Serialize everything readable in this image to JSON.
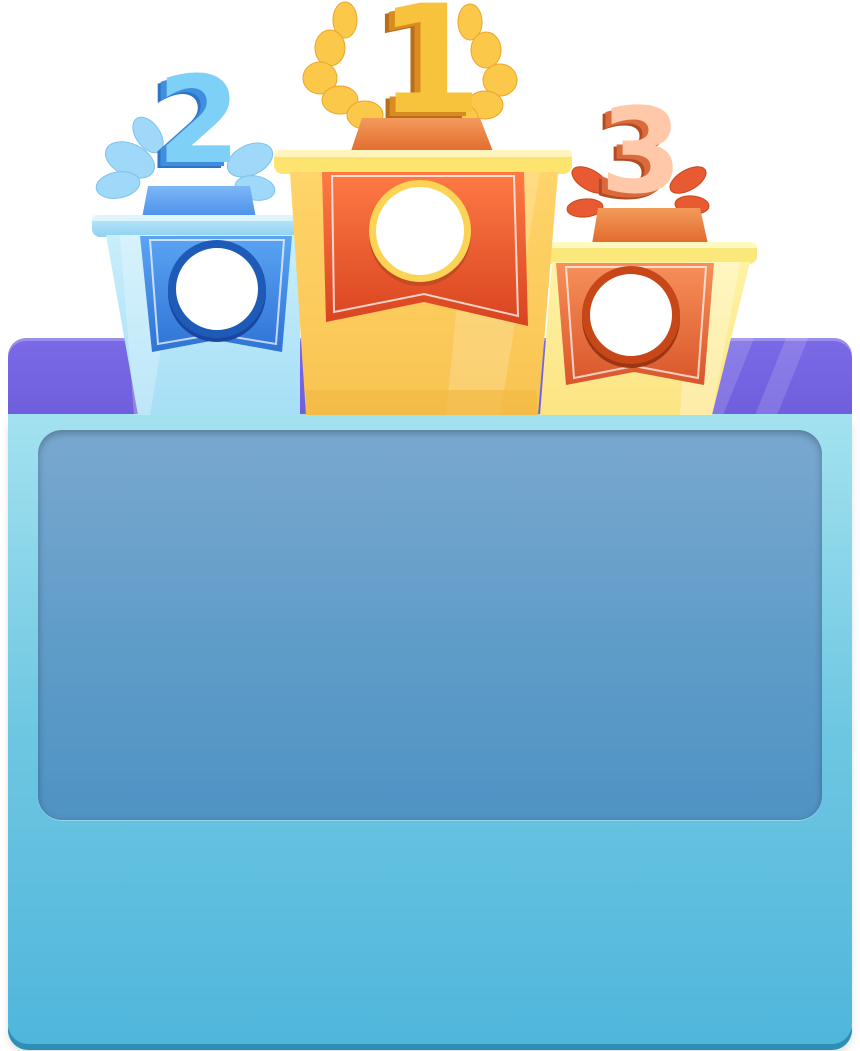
{
  "podium": {
    "first": {
      "rank_label": "1",
      "color": "#f7c33c",
      "banner_color": "#e8562f"
    },
    "second": {
      "rank_label": "2",
      "color": "#7fd0f7",
      "banner_color": "#2f73d6"
    },
    "third": {
      "rank_label": "3",
      "color": "#ffc8a8",
      "banner_color": "#d9562a"
    }
  },
  "theme": {
    "header_color": "#7566e2",
    "board_color": "#66c3e2",
    "panel_color": "#5f9cc8"
  },
  "icons": {
    "first_laurel": "laurel-wreath-icon",
    "second_laurel": "leaf-wreath-icon",
    "third_laurel": "leaf-wreath-icon"
  }
}
